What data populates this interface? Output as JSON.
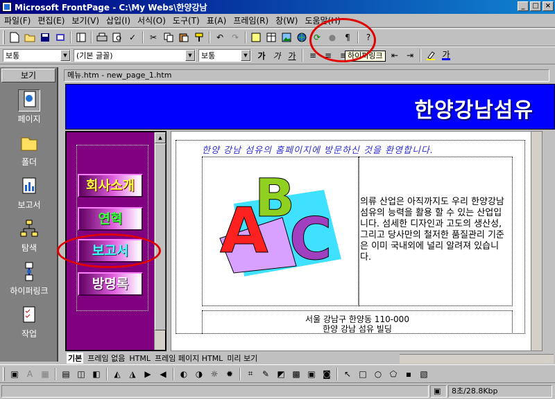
{
  "window": {
    "title": "Microsoft FrontPage - C:\\My Webs\\한양강남",
    "min": "_",
    "max": "□",
    "close": "×"
  },
  "menu": [
    "파일(F)",
    "편집(E)",
    "보기(V)",
    "삽입(I)",
    "서식(O)",
    "도구(T)",
    "표(A)",
    "프레임(R)",
    "창(W)",
    "도움말(H)"
  ],
  "format_bar": {
    "style": "보통",
    "font": "(기본 글꼴)",
    "size": "보통",
    "bold": "가",
    "italic": "가",
    "underline": "가",
    "font_color": "가"
  },
  "tooltip": "하이퍼링크",
  "views": {
    "title": "보기",
    "items": [
      "페이지",
      "폴더",
      "보고서",
      "탐색",
      "하이퍼링크",
      "작업"
    ]
  },
  "document": {
    "frame_title": "메뉴.htm - new_page_1.htm",
    "banner": "한양강남섬유",
    "nav_buttons": [
      "회사소개",
      "연혁",
      "보고서",
      "방명록"
    ],
    "welcome": "한양 강남 섬유의 홈페이지에 방문하신 것을 환영합니다.",
    "body_text": "의류 산업은 아직까지도 우리 한양강남 섬유의 능력을 활용 할 수 있는 산업입니다. 섬세한 디자인과 고도의 생산성, 그리고 당사만의 철저한 품질관리 기준은 이미 국내외에 널리 알려져 있습니다.",
    "address_line1": "서울 강남구 한양동 110-000",
    "address_line2": "한양 강남 섬유 빌딩",
    "clipart_letters": [
      "A",
      "B",
      "C"
    ]
  },
  "tabs": [
    "기본",
    "프레임 없음",
    "HTML",
    "프레임 페이지 HTML",
    "미리 보기"
  ],
  "status": {
    "time": "8초/28.8Kbp"
  },
  "colors": {
    "banner_bg": "#0000ff",
    "nav_bg": "#800080",
    "annotation": "#e00000"
  }
}
